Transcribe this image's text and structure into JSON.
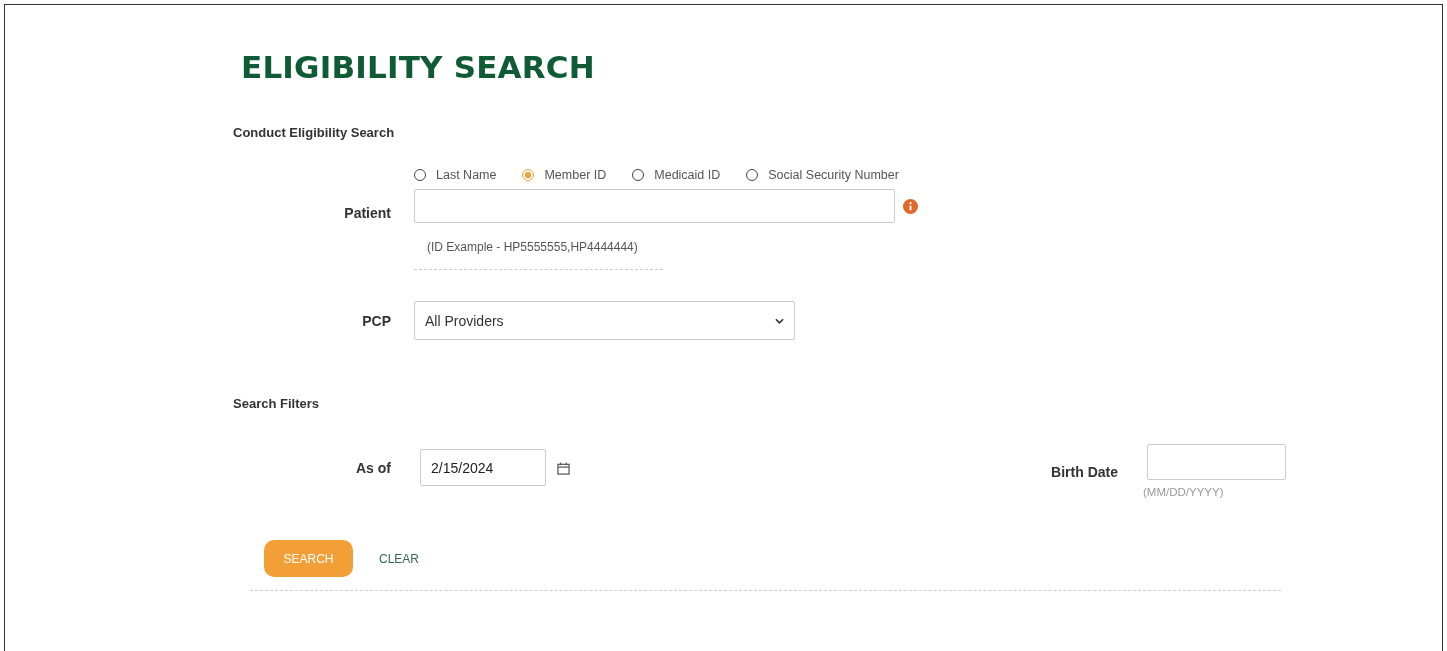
{
  "title": "ELIGIBILITY SEARCH",
  "search_section": {
    "heading": "Conduct Eligibility Search",
    "patient": {
      "label": "Patient",
      "id_types": [
        {
          "label": "Last Name",
          "selected": false
        },
        {
          "label": "Member ID",
          "selected": true
        },
        {
          "label": "Medicaid ID",
          "selected": false
        },
        {
          "label": "Social Security Number",
          "selected": false
        }
      ],
      "hint": "(ID Example - HP5555555,HP4444444)"
    },
    "pcp": {
      "label": "PCP",
      "value": "All Providers"
    }
  },
  "filters_section": {
    "heading": "Search Filters",
    "as_of": {
      "label": "As of",
      "value": "2/15/2024"
    },
    "birth_date": {
      "label": "Birth Date",
      "hint": "(MM/DD/YYYY)"
    }
  },
  "buttons": {
    "search": "SEARCH",
    "clear": "CLEAR"
  }
}
